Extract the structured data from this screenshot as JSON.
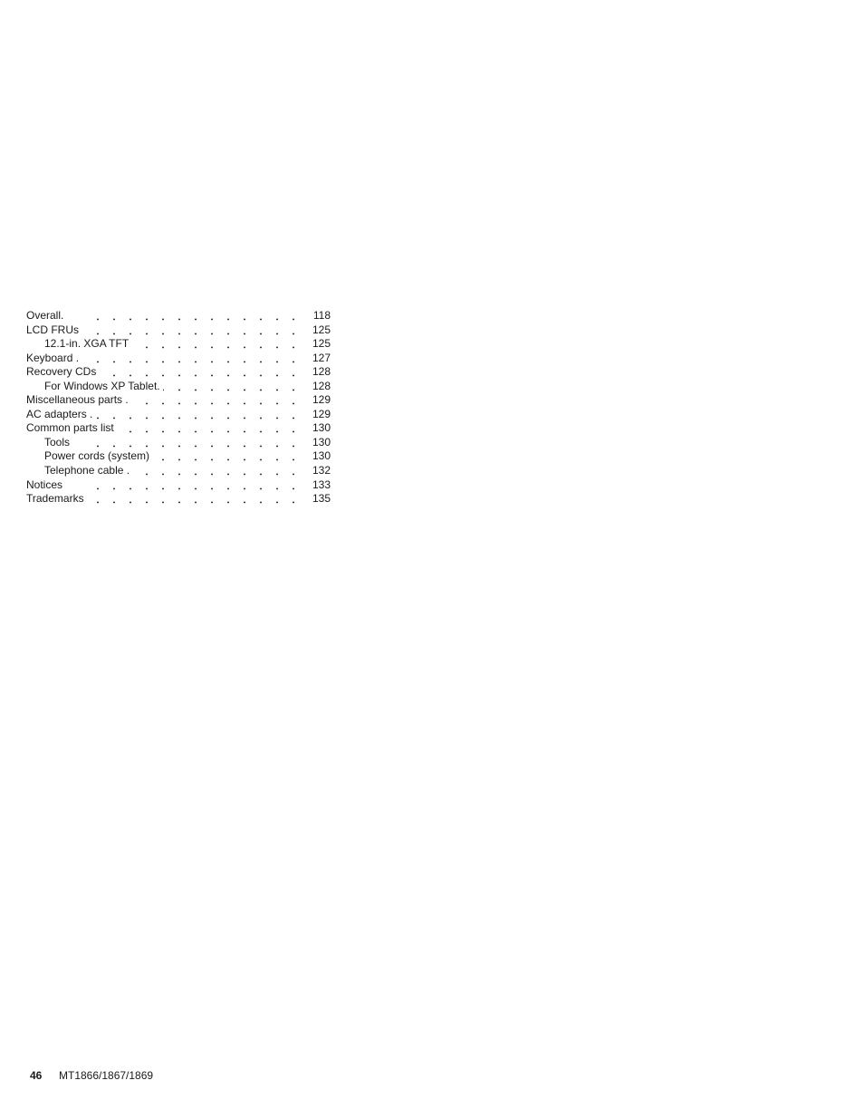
{
  "document": {
    "type": "table-of-contents-continuation",
    "text_color": "#1a1a1a",
    "background_color": "#ffffff"
  },
  "toc": {
    "entries": [
      {
        "label": "Overall.",
        "level": 0,
        "page": "118"
      },
      {
        "label": "LCD FRUs",
        "level": 0,
        "page": "125"
      },
      {
        "label": "12.1-in. XGA TFT",
        "level": 1,
        "page": "125"
      },
      {
        "label": "Keyboard .",
        "level": 0,
        "page": "127"
      },
      {
        "label": "Recovery CDs",
        "level": 0,
        "page": "128"
      },
      {
        "label": "For Windows XP Tablet.",
        "level": 1,
        "page": "128"
      },
      {
        "label": "Miscellaneous parts .",
        "level": 0,
        "page": "129"
      },
      {
        "label": "AC adapters .",
        "level": 0,
        "page": "129"
      },
      {
        "label": "Common parts list",
        "level": 0,
        "page": "130"
      },
      {
        "label": "Tools",
        "level": 1,
        "page": "130"
      },
      {
        "label": "Power cords (system)",
        "level": 1,
        "page": "130"
      },
      {
        "label": "Telephone cable .",
        "level": 1,
        "page": "132"
      },
      {
        "label": "Notices",
        "level": -1,
        "page": "133"
      },
      {
        "label": "Trademarks",
        "level": -1,
        "page": "135"
      }
    ]
  },
  "footer": {
    "page_number": "46",
    "model": "MT1866/1867/1869"
  }
}
